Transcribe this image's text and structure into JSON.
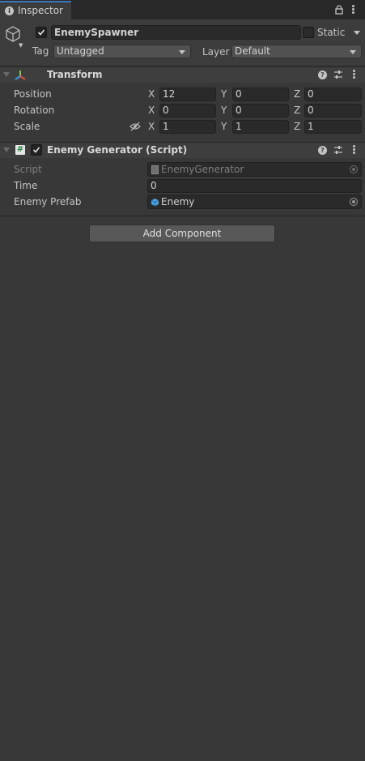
{
  "tab": {
    "title": "Inspector"
  },
  "gameobject": {
    "name": "EnemySpawner",
    "active": true,
    "static_label": "Static",
    "tag_label": "Tag",
    "tag_value": "Untagged",
    "layer_label": "Layer",
    "layer_value": "Default"
  },
  "transform": {
    "title": "Transform",
    "rows": [
      {
        "label": "Position",
        "x": "12",
        "y": "0",
        "z": "0"
      },
      {
        "label": "Rotation",
        "x": "0",
        "y": "0",
        "z": "0"
      },
      {
        "label": "Scale",
        "x": "1",
        "y": "1",
        "z": "1"
      }
    ],
    "axis": {
      "x": "X",
      "y": "Y",
      "z": "Z"
    }
  },
  "script_component": {
    "title": "Enemy Generator (Script)",
    "enabled": true,
    "script_label": "Script",
    "script_value": "EnemyGenerator",
    "time_label": "Time",
    "time_value": "0",
    "prefab_label": "Enemy Prefab",
    "prefab_value": "Enemy"
  },
  "add_component_label": "Add Component",
  "colors": {
    "accent": "#3a79bb",
    "background": "#383838",
    "prefab_icon": "#4aa3e0"
  },
  "icons": [
    "info-icon",
    "lock-icon",
    "more-icon",
    "cube-icon",
    "transform-icon",
    "help-icon",
    "sliders-icon",
    "script-icon",
    "eye-hidden-icon",
    "prefab-icon",
    "target-icon"
  ]
}
